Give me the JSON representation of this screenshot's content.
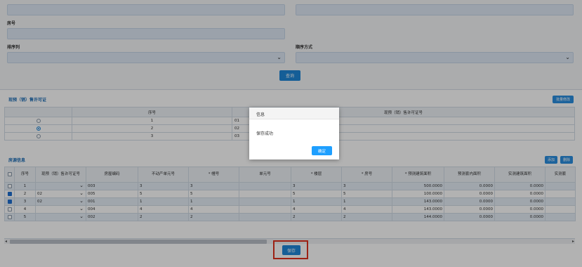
{
  "filters": {
    "room_label": "房号",
    "sort_col_label": "排序列",
    "sort_dir_label": "顺序方式",
    "query_button": "查询"
  },
  "cert_section": {
    "title": "现预（销）售许可证",
    "batch_edit_button": "批量修改",
    "headers": [
      "序号",
      "现预（销）售许可证号"
    ],
    "rows": [
      {
        "index": "1",
        "cert": "01",
        "selected": false
      },
      {
        "index": "2",
        "cert": "02",
        "selected": true
      },
      {
        "index": "3",
        "cert": "03",
        "selected": false
      }
    ]
  },
  "house_section": {
    "title": "房源信息",
    "add_button": "添加",
    "delete_button": "删除",
    "headers": [
      "序号",
      "现预（销）售许可证号",
      "房屋编码",
      "不动产单元号",
      "* 幢号",
      "单元号",
      "* 楼层",
      "* 房号",
      "* 预测建筑面积",
      "预测套内面积",
      "实测建筑面积",
      "实测套"
    ],
    "rows": [
      {
        "checked": false,
        "index": "1",
        "cert": "",
        "code": "003",
        "unit_no": "3",
        "building": "3",
        "unit": "",
        "floor": "3",
        "room": "3",
        "pred_area": "500.0000",
        "pred_inner": "0.0000",
        "real_area": "0.0000"
      },
      {
        "checked": true,
        "index": "2",
        "cert": "02",
        "code": "005",
        "unit_no": "5",
        "building": "5",
        "unit": "",
        "floor": "5",
        "room": "5",
        "pred_area": "100.0000",
        "pred_inner": "0.0000",
        "real_area": "0.0000"
      },
      {
        "checked": true,
        "index": "3",
        "cert": "02",
        "code": "001",
        "unit_no": "1",
        "building": "1",
        "unit": "",
        "floor": "1",
        "room": "1",
        "pred_area": "143.0000",
        "pred_inner": "0.0000",
        "real_area": "0.0000"
      },
      {
        "checked": false,
        "index": "4",
        "cert": "",
        "code": "004",
        "unit_no": "4",
        "building": "4",
        "unit": "",
        "floor": "4",
        "room": "4",
        "pred_area": "143.0000",
        "pred_inner": "0.0000",
        "real_area": "0.0000"
      },
      {
        "checked": false,
        "index": "5",
        "cert": "",
        "code": "002",
        "unit_no": "2",
        "building": "2",
        "unit": "",
        "floor": "2",
        "room": "2",
        "pred_area": "144.0000",
        "pred_inner": "0.0000",
        "real_area": "0.0000"
      }
    ]
  },
  "save_button": "保存",
  "dialog": {
    "title": "信息",
    "message": "保存成功",
    "ok_button": "确定"
  },
  "colors": {
    "primary": "#1f87d8",
    "dialog_ok": "#1e9fff",
    "highlight_border": "#e0301e"
  }
}
